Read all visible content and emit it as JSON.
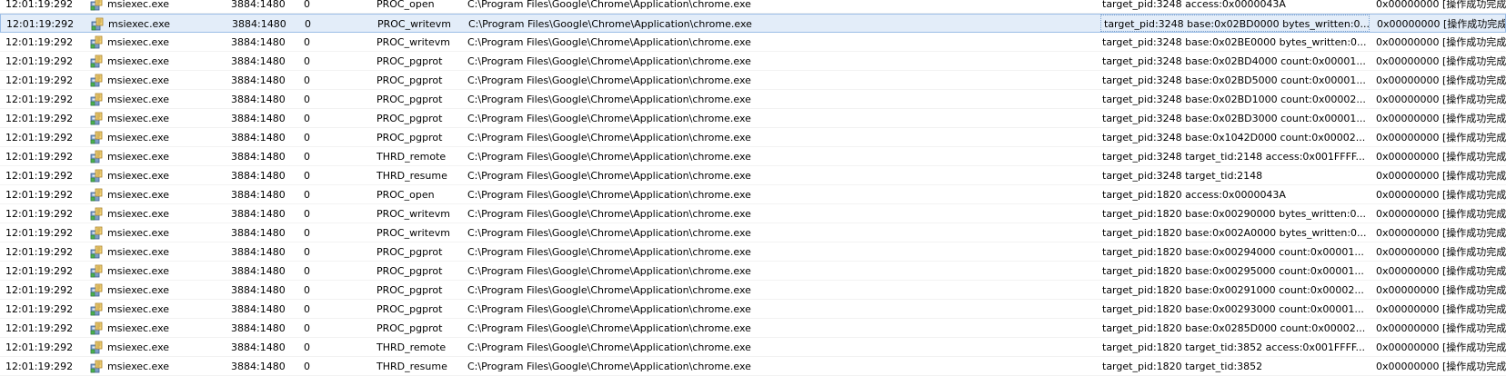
{
  "icons": {
    "process": "installer-package-icon"
  },
  "colors": {
    "selected_row_bg": "#e3edf9",
    "selected_row_border": "#9bbde6"
  },
  "rows": [
    {
      "time": "12:01:19:292",
      "process": "msiexec.exe",
      "pid_tid": "3884:1480",
      "num": "0",
      "operation": "PROC_open",
      "path": "C:\\Program Files\\Google\\Chrome\\Application\\chrome.exe",
      "detail": "target_pid:3248 access:0x0000043A",
      "result": "0x00000000 [操作成功完成"
    },
    {
      "time": "12:01:19:292",
      "process": "msiexec.exe",
      "pid_tid": "3884:1480",
      "num": "0",
      "operation": "PROC_writevm",
      "path": "C:\\Program Files\\Google\\Chrome\\Application\\chrome.exe",
      "detail": "target_pid:3248 base:0x02BD0000 bytes_written:0...",
      "result": "0x00000000 [操作成功完成",
      "selected": true
    },
    {
      "time": "12:01:19:292",
      "process": "msiexec.exe",
      "pid_tid": "3884:1480",
      "num": "0",
      "operation": "PROC_writevm",
      "path": "C:\\Program Files\\Google\\Chrome\\Application\\chrome.exe",
      "detail": "target_pid:3248 base:0x02BE0000 bytes_written:0...",
      "result": "0x00000000 [操作成功完成"
    },
    {
      "time": "12:01:19:292",
      "process": "msiexec.exe",
      "pid_tid": "3884:1480",
      "num": "0",
      "operation": "PROC_pgprot",
      "path": "C:\\Program Files\\Google\\Chrome\\Application\\chrome.exe",
      "detail": "target_pid:3248 base:0x02BD4000 count:0x00001...",
      "result": "0x00000000 [操作成功完成"
    },
    {
      "time": "12:01:19:292",
      "process": "msiexec.exe",
      "pid_tid": "3884:1480",
      "num": "0",
      "operation": "PROC_pgprot",
      "path": "C:\\Program Files\\Google\\Chrome\\Application\\chrome.exe",
      "detail": "target_pid:3248 base:0x02BD5000 count:0x00001...",
      "result": "0x00000000 [操作成功完成"
    },
    {
      "time": "12:01:19:292",
      "process": "msiexec.exe",
      "pid_tid": "3884:1480",
      "num": "0",
      "operation": "PROC_pgprot",
      "path": "C:\\Program Files\\Google\\Chrome\\Application\\chrome.exe",
      "detail": "target_pid:3248 base:0x02BD1000 count:0x00002...",
      "result": "0x00000000 [操作成功完成"
    },
    {
      "time": "12:01:19:292",
      "process": "msiexec.exe",
      "pid_tid": "3884:1480",
      "num": "0",
      "operation": "PROC_pgprot",
      "path": "C:\\Program Files\\Google\\Chrome\\Application\\chrome.exe",
      "detail": "target_pid:3248 base:0x02BD3000 count:0x00001...",
      "result": "0x00000000 [操作成功完成"
    },
    {
      "time": "12:01:19:292",
      "process": "msiexec.exe",
      "pid_tid": "3884:1480",
      "num": "0",
      "operation": "PROC_pgprot",
      "path": "C:\\Program Files\\Google\\Chrome\\Application\\chrome.exe",
      "detail": "target_pid:3248 base:0x1042D000 count:0x00002...",
      "result": "0x00000000 [操作成功完成"
    },
    {
      "time": "12:01:19:292",
      "process": "msiexec.exe",
      "pid_tid": "3884:1480",
      "num": "0",
      "operation": "THRD_remote",
      "path": "C:\\Program Files\\Google\\Chrome\\Application\\chrome.exe",
      "detail": "target_pid:3248 target_tid:2148 access:0x001FFFF...",
      "result": "0x00000000 [操作成功完成"
    },
    {
      "time": "12:01:19:292",
      "process": "msiexec.exe",
      "pid_tid": "3884:1480",
      "num": "0",
      "operation": "THRD_resume",
      "path": "C:\\Program Files\\Google\\Chrome\\Application\\chrome.exe",
      "detail": "target_pid:3248 target_tid:2148",
      "result": "0x00000000 [操作成功完成"
    },
    {
      "time": "12:01:19:292",
      "process": "msiexec.exe",
      "pid_tid": "3884:1480",
      "num": "0",
      "operation": "PROC_open",
      "path": "C:\\Program Files\\Google\\Chrome\\Application\\chrome.exe",
      "detail": "target_pid:1820 access:0x0000043A",
      "result": "0x00000000 [操作成功完成"
    },
    {
      "time": "12:01:19:292",
      "process": "msiexec.exe",
      "pid_tid": "3884:1480",
      "num": "0",
      "operation": "PROC_writevm",
      "path": "C:\\Program Files\\Google\\Chrome\\Application\\chrome.exe",
      "detail": "target_pid:1820 base:0x00290000 bytes_written:0...",
      "result": "0x00000000 [操作成功完成"
    },
    {
      "time": "12:01:19:292",
      "process": "msiexec.exe",
      "pid_tid": "3884:1480",
      "num": "0",
      "operation": "PROC_writevm",
      "path": "C:\\Program Files\\Google\\Chrome\\Application\\chrome.exe",
      "detail": "target_pid:1820 base:0x002A0000 bytes_written:0...",
      "result": "0x00000000 [操作成功完成"
    },
    {
      "time": "12:01:19:292",
      "process": "msiexec.exe",
      "pid_tid": "3884:1480",
      "num": "0",
      "operation": "PROC_pgprot",
      "path": "C:\\Program Files\\Google\\Chrome\\Application\\chrome.exe",
      "detail": "target_pid:1820 base:0x00294000 count:0x00001...",
      "result": "0x00000000 [操作成功完成"
    },
    {
      "time": "12:01:19:292",
      "process": "msiexec.exe",
      "pid_tid": "3884:1480",
      "num": "0",
      "operation": "PROC_pgprot",
      "path": "C:\\Program Files\\Google\\Chrome\\Application\\chrome.exe",
      "detail": "target_pid:1820 base:0x00295000 count:0x00001...",
      "result": "0x00000000 [操作成功完成"
    },
    {
      "time": "12:01:19:292",
      "process": "msiexec.exe",
      "pid_tid": "3884:1480",
      "num": "0",
      "operation": "PROC_pgprot",
      "path": "C:\\Program Files\\Google\\Chrome\\Application\\chrome.exe",
      "detail": "target_pid:1820 base:0x00291000 count:0x00002...",
      "result": "0x00000000 [操作成功完成"
    },
    {
      "time": "12:01:19:292",
      "process": "msiexec.exe",
      "pid_tid": "3884:1480",
      "num": "0",
      "operation": "PROC_pgprot",
      "path": "C:\\Program Files\\Google\\Chrome\\Application\\chrome.exe",
      "detail": "target_pid:1820 base:0x00293000 count:0x00001...",
      "result": "0x00000000 [操作成功完成"
    },
    {
      "time": "12:01:19:292",
      "process": "msiexec.exe",
      "pid_tid": "3884:1480",
      "num": "0",
      "operation": "PROC_pgprot",
      "path": "C:\\Program Files\\Google\\Chrome\\Application\\chrome.exe",
      "detail": "target_pid:1820 base:0x0285D000 count:0x00002...",
      "result": "0x00000000 [操作成功完成"
    },
    {
      "time": "12:01:19:292",
      "process": "msiexec.exe",
      "pid_tid": "3884:1480",
      "num": "0",
      "operation": "THRD_remote",
      "path": "C:\\Program Files\\Google\\Chrome\\Application\\chrome.exe",
      "detail": "target_pid:1820 target_tid:3852 access:0x001FFFF...",
      "result": "0x00000000 [操作成功完成"
    },
    {
      "time": "12:01:19:292",
      "process": "msiexec.exe",
      "pid_tid": "3884:1480",
      "num": "0",
      "operation": "THRD_resume",
      "path": "C:\\Program Files\\Google\\Chrome\\Application\\chrome.exe",
      "detail": "target_pid:1820 target_tid:3852",
      "result": "0x00000000 [操作成功完成"
    }
  ]
}
